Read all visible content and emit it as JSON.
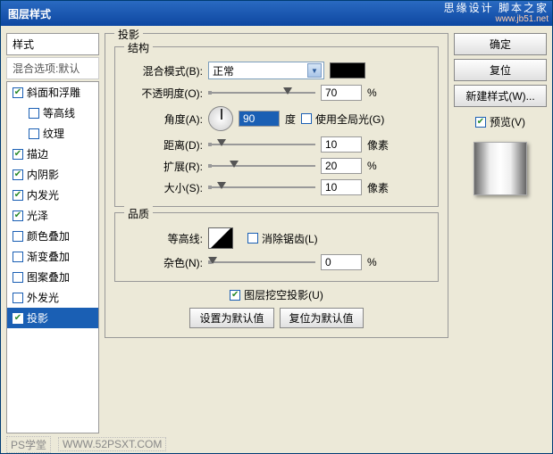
{
  "titlebar": {
    "title": "图层样式",
    "brand1": "思缘设计 脚本之家",
    "brand2": "www.jb51.net"
  },
  "sidebar": {
    "header": "样式",
    "subheader": "混合选项:默认",
    "items": [
      {
        "label": "斜面和浮雕",
        "checked": true,
        "indent": false
      },
      {
        "label": "等高线",
        "checked": false,
        "indent": true
      },
      {
        "label": "纹理",
        "checked": false,
        "indent": true
      },
      {
        "label": "描边",
        "checked": true,
        "indent": false
      },
      {
        "label": "内阴影",
        "checked": true,
        "indent": false
      },
      {
        "label": "内发光",
        "checked": true,
        "indent": false
      },
      {
        "label": "光泽",
        "checked": true,
        "indent": false
      },
      {
        "label": "颜色叠加",
        "checked": false,
        "indent": false
      },
      {
        "label": "渐变叠加",
        "checked": false,
        "indent": false
      },
      {
        "label": "图案叠加",
        "checked": false,
        "indent": false
      },
      {
        "label": "外发光",
        "checked": false,
        "indent": false
      },
      {
        "label": "投影",
        "checked": true,
        "indent": false,
        "selected": true
      }
    ]
  },
  "main": {
    "group_title": "投影",
    "structure": {
      "title": "结构",
      "blend_mode_label": "混合模式(B):",
      "blend_mode_value": "正常",
      "opacity_label": "不透明度(O):",
      "opacity_value": "70",
      "pct": "%",
      "angle_label": "角度(A):",
      "angle_value": "90",
      "degree": "度",
      "global_light": "使用全局光(G)",
      "distance_label": "距离(D):",
      "distance_value": "10",
      "px": "像素",
      "spread_label": "扩展(R):",
      "spread_value": "20",
      "size_label": "大小(S):",
      "size_value": "10"
    },
    "quality": {
      "title": "品质",
      "contour_label": "等高线:",
      "antialias": "消除锯齿(L)",
      "noise_label": "杂色(N):",
      "noise_value": "0"
    },
    "knockout": "图层挖空投影(U)",
    "set_default": "设置为默认值",
    "reset_default": "复位为默认值"
  },
  "right": {
    "ok": "确定",
    "cancel": "复位",
    "new_style": "新建样式(W)...",
    "preview": "预览(V)"
  },
  "footer": {
    "a": "PS学堂",
    "b": "WWW.52PSXT.COM"
  }
}
